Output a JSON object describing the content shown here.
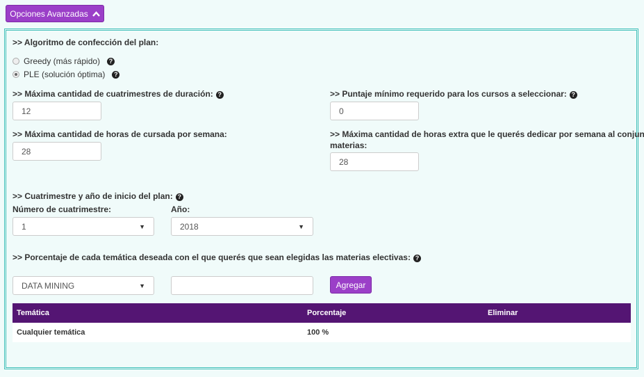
{
  "toggle": {
    "label": "Opciones Avanzadas",
    "icon": "chevron-up-icon"
  },
  "algorithm": {
    "label": ">> Algoritmo de confección del plan:",
    "options": [
      {
        "label": "Greedy (más rápido)",
        "checked": false
      },
      {
        "label": "PLE (solución óptima)",
        "checked": true
      }
    ]
  },
  "max_quarters": {
    "label": ">> Máxima cantidad de cuatrimestres de duración:",
    "value": "12"
  },
  "min_score": {
    "label": ">> Puntaje mínimo requerido para los cursos a seleccionar:",
    "value": "0"
  },
  "max_hours": {
    "label": ">> Máxima cantidad de horas de cursada por semana:",
    "value": "28"
  },
  "extra_hours": {
    "label_line1": ">> Máxima cantidad de horas extra que le querés dedicar por semana al conjunto de",
    "label_line2": "materias:",
    "value": "28"
  },
  "start": {
    "label": ">> Cuatrimestre y año de inicio del plan:",
    "quarter_label": "Número de cuatrimestre:",
    "quarter_value": "1",
    "year_label": "Año:",
    "year_value": "2018"
  },
  "thematic": {
    "label": ">> Porcentaje de cada temática deseada con el que querés que sean elegidas las materias electivas:",
    "select_value": "DATA MINING",
    "percent_value": "",
    "add_label": "Agregar"
  },
  "table": {
    "headers": [
      "Temática",
      "Porcentaje",
      "Eliminar"
    ],
    "rows": [
      {
        "tematica": "Cualquier temática",
        "porcentaje": "100 %",
        "eliminar": ""
      }
    ]
  },
  "colors": {
    "accent": "#9b3fc8",
    "table_header": "#541573",
    "border": "#3fbfb8"
  }
}
